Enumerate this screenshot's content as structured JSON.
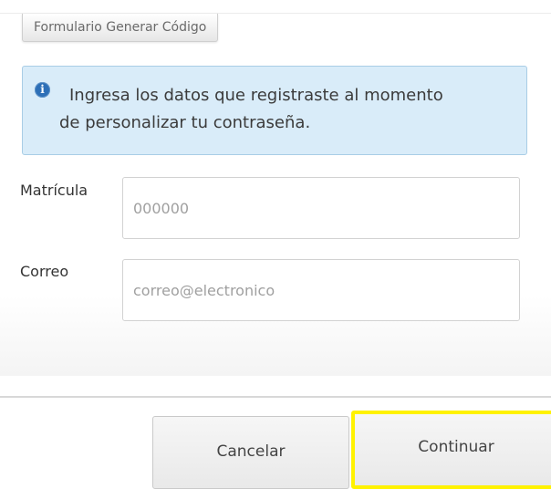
{
  "tab": {
    "label": "Formulario Generar Código"
  },
  "alert": {
    "icon": "info-icon",
    "line1": "Ingresa los datos que registraste al momento",
    "line2": "de personalizar tu contraseña."
  },
  "form": {
    "matricula": {
      "label": "Matrícula",
      "placeholder": "000000",
      "value": ""
    },
    "correo": {
      "label": "Correo",
      "placeholder": "correo@electronico",
      "value": ""
    }
  },
  "buttons": {
    "cancel_label": "Cancelar",
    "continue_label": "Continuar"
  },
  "colors": {
    "alert_background": "#d9ecf9",
    "alert_border": "#a9cde6",
    "info_icon": "#2d6fb7",
    "highlight": "#fff200"
  }
}
